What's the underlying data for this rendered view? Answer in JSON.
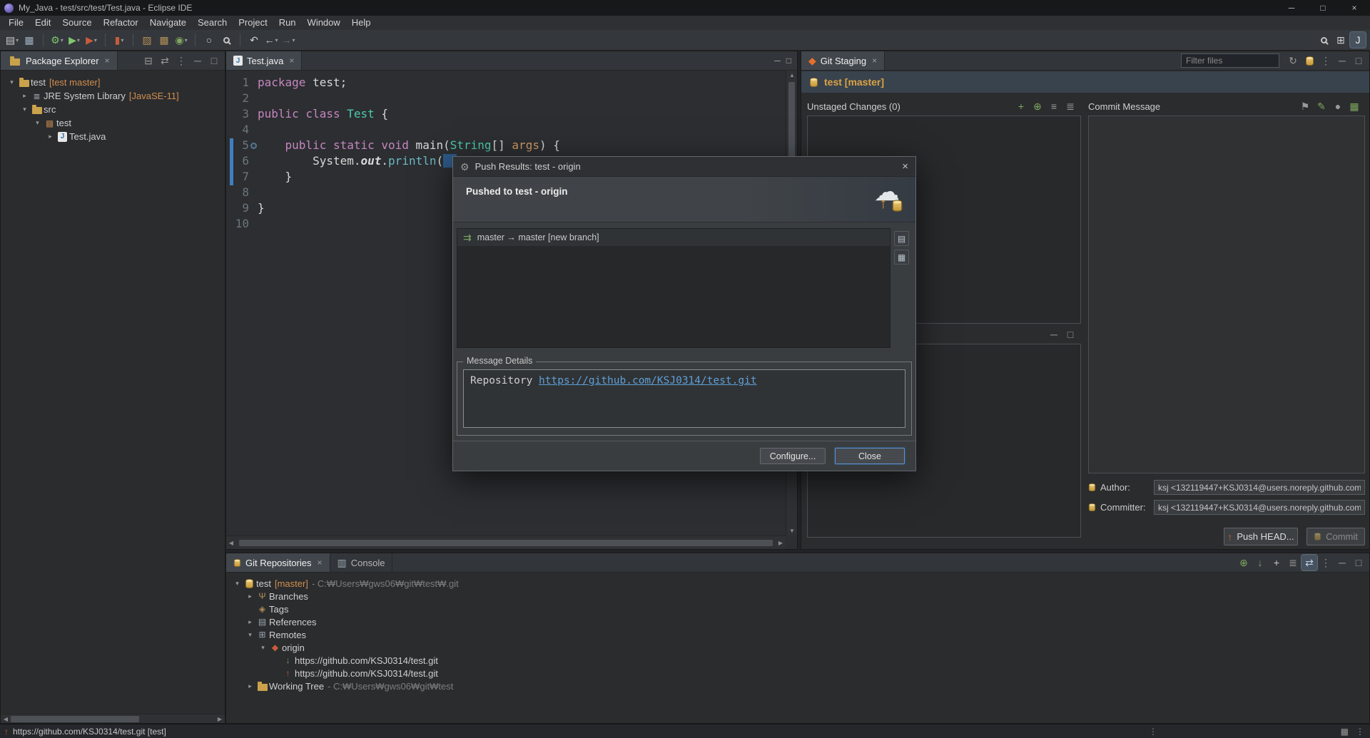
{
  "ui": {
    "close_glyph": "×",
    "min_glyph": "─",
    "max_glyph": "□",
    "up_arrow": "▲",
    "down_arrow": "▼",
    "left_arrow": "◀",
    "right_arrow": "▶"
  },
  "titlebar": {
    "title": "My_Java - test/src/test/Test.java - Eclipse IDE",
    "minimize": "─",
    "maximize": "□",
    "close": "×"
  },
  "menubar": {
    "items": [
      "File",
      "Edit",
      "Source",
      "Refactor",
      "Navigate",
      "Search",
      "Project",
      "Run",
      "Window",
      "Help"
    ]
  },
  "toolbar": {
    "groups": [
      {
        "icons": [
          {
            "name": "new-wizard-icon",
            "glyph": "▤",
            "color": "#cfcfcf",
            "caret": true
          },
          {
            "name": "save-icon",
            "glyph": "▦",
            "color": "#9fb0c4"
          }
        ]
      },
      {
        "icons": [
          {
            "name": "debug-icon",
            "glyph": "⚙",
            "color": "#7fc76e",
            "caret": true
          },
          {
            "name": "run-icon",
            "glyph": "▶",
            "color": "#7fc76e",
            "caret": true
          },
          {
            "name": "external-tools-icon",
            "glyph": "▶",
            "color": "#c75c3a",
            "caret": true
          }
        ]
      },
      {
        "icons": [
          {
            "name": "coverage-icon",
            "glyph": "▮",
            "color": "#c75c3a",
            "caret": true
          }
        ]
      },
      {
        "icons": [
          {
            "name": "new-java-project-icon",
            "glyph": "▨",
            "color": "#b08d57"
          },
          {
            "name": "new-package-icon",
            "glyph": "▩",
            "color": "#b08d57"
          },
          {
            "name": "new-class-icon",
            "glyph": "◉",
            "color": "#7fa85f",
            "caret": true
          }
        ]
      },
      {
        "icons": [
          {
            "name": "open-type-icon",
            "glyph": "○",
            "color": "#cfcfcf"
          },
          {
            "name": "search-icon",
            "glyph": "mag",
            "color": "#cfcfcf"
          }
        ]
      },
      {
        "icons": [
          {
            "name": "last-edit-location-icon",
            "glyph": "↶",
            "color": "#cfcfcf"
          },
          {
            "name": "back-icon",
            "glyph": "←",
            "color": "#cfcfcf",
            "caret": true
          },
          {
            "name": "forward-icon",
            "glyph": "→",
            "color": "#6f6f6f",
            "caret": true
          }
        ]
      }
    ],
    "right_icons": [
      {
        "name": "search-icon",
        "glyph": "mag",
        "color": "#cfcfcf"
      },
      {
        "name": "open-perspective-icon",
        "glyph": "⊞",
        "color": "#cfcfcf"
      },
      {
        "name": "java-perspective-icon",
        "glyph": "J",
        "color": "#e8e8e8",
        "active": true
      }
    ]
  },
  "package_explorer": {
    "tab": "Package Explorer",
    "toolbar": [
      {
        "name": "collapse-all-icon",
        "glyph": "⊟",
        "color": "#9a9a9a"
      },
      {
        "name": "link-with-editor-icon",
        "glyph": "⇄",
        "color": "#9a9a9a"
      },
      {
        "name": "view-menu-icon",
        "glyph": "⋮",
        "color": "#9a9a9a"
      },
      {
        "name": "minimize-icon",
        "glyph": "─",
        "color": "#9a9a9a"
      },
      {
        "name": "maximize-icon",
        "glyph": "□",
        "color": "#9a9a9a"
      }
    ],
    "tree": [
      {
        "level": 0,
        "expander": "▾",
        "icon": "project",
        "label": "test",
        "decor": "[test master]"
      },
      {
        "level": 1,
        "expander": "▸",
        "icon": "jre",
        "label": "JRE System Library",
        "decor": "[JavaSE-11]"
      },
      {
        "level": 1,
        "expander": "▾",
        "icon": "src",
        "label": "src",
        "decor": ""
      },
      {
        "level": 2,
        "expander": "▾",
        "icon": "pkg",
        "label": "test",
        "decor": ""
      },
      {
        "level": 3,
        "expander": "▸",
        "icon": "java",
        "label": "Test.java",
        "decor": ""
      }
    ]
  },
  "editor": {
    "tab": "Test.java",
    "lines": [
      {
        "n": "1",
        "segs": [
          {
            "t": "package",
            "c": "kw"
          },
          {
            "t": " test;",
            "c": "pl"
          }
        ]
      },
      {
        "n": "2",
        "segs": []
      },
      {
        "n": "3",
        "segs": [
          {
            "t": "public class",
            "c": "kw"
          },
          {
            "t": " ",
            "c": "pl"
          },
          {
            "t": "Test",
            "c": "cls"
          },
          {
            "t": " {",
            "c": "pl"
          }
        ]
      },
      {
        "n": "4",
        "segs": []
      },
      {
        "n": "5",
        "segs": [
          {
            "t": "    ",
            "c": "pl"
          },
          {
            "t": "public static void",
            "c": "kw"
          },
          {
            "t": " main(",
            "c": "pl"
          },
          {
            "t": "String",
            "c": "cls"
          },
          {
            "t": "[] ",
            "c": "pl"
          },
          {
            "t": "args",
            "c": "arg"
          },
          {
            "t": ") {",
            "c": "pl"
          }
        ]
      },
      {
        "n": "6",
        "segs": [
          {
            "t": "        System.",
            "c": "pl"
          },
          {
            "t": "out",
            "c": "fld"
          },
          {
            "t": ".",
            "c": "pl"
          },
          {
            "t": "println",
            "c": "meth"
          },
          {
            "t": "(",
            "c": "pl"
          },
          {
            "t": "  ",
            "c": "sel"
          }
        ]
      },
      {
        "n": "7",
        "segs": [
          {
            "t": "    }",
            "c": "pl"
          }
        ]
      },
      {
        "n": "8",
        "segs": []
      },
      {
        "n": "9",
        "segs": [
          {
            "t": "}",
            "c": "pl"
          }
        ]
      },
      {
        "n": "10",
        "segs": []
      }
    ]
  },
  "staging": {
    "tab": "Git Staging",
    "filter_placeholder": "Filter files",
    "toolbar": [
      {
        "name": "refresh-icon",
        "glyph": "↻",
        "color": "#9a9a9a"
      },
      {
        "name": "switch-repository-icon",
        "glyph": "cyl",
        "color": "#c79b3a"
      },
      {
        "name": "view-menu-icon",
        "glyph": "⋮",
        "color": "#9a9a9a"
      },
      {
        "name": "minimize-icon",
        "glyph": "─",
        "color": "#9a9a9a"
      },
      {
        "name": "maximize-icon",
        "glyph": "□",
        "color": "#9a9a9a"
      }
    ],
    "repo_label": "test [master]",
    "unstaged_label": "Unstaged Changes (0)",
    "unstaged_icons": [
      {
        "name": "add-selected-icon",
        "glyph": "+",
        "color": "#7fa85f"
      },
      {
        "name": "add-all-icon",
        "glyph": "⊕",
        "color": "#7fa85f"
      },
      {
        "name": "presentation-flat-icon",
        "glyph": "≡",
        "color": "#9a9a9a"
      },
      {
        "name": "presentation-tree-icon",
        "glyph": "≣",
        "color": "#9a9a9a"
      }
    ],
    "staged_icons": [
      {
        "name": "minimize-section-icon",
        "glyph": "─",
        "color": "#9a9a9a"
      },
      {
        "name": "restore-section-icon",
        "glyph": "□",
        "color": "#9a9a9a"
      }
    ],
    "commit_label": "Commit Message",
    "commit_icons": [
      {
        "name": "amend-commit-icon",
        "glyph": "⚑",
        "color": "#9a9a9a"
      },
      {
        "name": "signed-off-by-icon",
        "glyph": "✎",
        "color": "#7fa85f"
      },
      {
        "name": "sign-commit-icon",
        "glyph": "●",
        "color": "#9a9a9a"
      },
      {
        "name": "add-change-id-icon",
        "glyph": "▦",
        "color": "#7fa85f"
      }
    ],
    "author_label": "Author:",
    "author_value": "ksj <132119447+KSJ0314@users.noreply.github.com>",
    "committer_label": "Committer:",
    "committer_value": "ksj <132119447+KSJ0314@users.noreply.github.com>",
    "push_button": "Push HEAD...",
    "commit_button": "Commit"
  },
  "dialog": {
    "title": "Push Results: test - origin",
    "header": "Pushed to test - origin",
    "result_row": "master → master [new branch]",
    "side_icons": [
      {
        "name": "copy-details-icon",
        "glyph": "▤",
        "color": "#b9c4cc"
      },
      {
        "name": "open-in-commit-viewer-icon",
        "glyph": "▦",
        "color": "#b9c4cc"
      }
    ],
    "details_label": "Message Details",
    "repository_label": "Repository ",
    "repository_url": "https://github.com/KSJ0314/test.git",
    "configure_button": "Configure...",
    "close_button": "Close"
  },
  "repositories": {
    "tab": "Git Repositories",
    "console_tab": "Console",
    "toolbar": [
      {
        "name": "add-repository-icon",
        "glyph": "⊕",
        "color": "#7fa85f"
      },
      {
        "name": "clone-repository-icon",
        "glyph": "↓",
        "color": "#7fa85f"
      },
      {
        "name": "create-repository-icon",
        "glyph": "+",
        "color": "#c9c9c9"
      },
      {
        "name": "branch-hierarchy-icon",
        "glyph": "≣",
        "color": "#9a9a9a"
      },
      {
        "name": "link-with-selection-icon",
        "glyph": "⇄",
        "color": "#bcd2e8",
        "active": true
      },
      {
        "name": "view-menu-icon",
        "glyph": "⋮",
        "color": "#9a9a9a"
      },
      {
        "name": "minimize-icon",
        "glyph": "─",
        "color": "#9a9a9a"
      },
      {
        "name": "maximize-icon",
        "glyph": "□",
        "color": "#9a9a9a"
      }
    ],
    "tree": [
      {
        "level": 0,
        "expander": "▾",
        "icon": "repo",
        "label": "test",
        "decor": "[master]",
        "path": " - C:₩Users₩gws06₩git₩test₩.git"
      },
      {
        "level": 1,
        "expander": "▸",
        "icon": "branches",
        "label": "Branches",
        "decor": "",
        "path": ""
      },
      {
        "level": 1,
        "expander": "",
        "icon": "tags",
        "label": "Tags",
        "decor": "",
        "path": ""
      },
      {
        "level": 1,
        "expander": "▸",
        "icon": "refs",
        "label": "References",
        "decor": "",
        "path": ""
      },
      {
        "level": 1,
        "expander": "▾",
        "icon": "remotes",
        "label": "Remotes",
        "decor": "",
        "path": ""
      },
      {
        "level": 2,
        "expander": "▾",
        "icon": "remote",
        "label": "origin",
        "decor": "",
        "path": ""
      },
      {
        "level": 3,
        "expander": "",
        "icon": "fetch",
        "label": "https://github.com/KSJ0314/test.git",
        "decor": "",
        "path": ""
      },
      {
        "level": 3,
        "expander": "",
        "icon": "push",
        "label": "https://github.com/KSJ0314/test.git",
        "decor": "",
        "path": ""
      },
      {
        "level": 1,
        "expander": "▸",
        "icon": "worktree",
        "label": "Working Tree",
        "decor": "",
        "path": " - C:₩Users₩gws06₩git₩test"
      }
    ]
  },
  "statusbar": {
    "text": "https://github.com/KSJ0314/test.git [test]"
  }
}
